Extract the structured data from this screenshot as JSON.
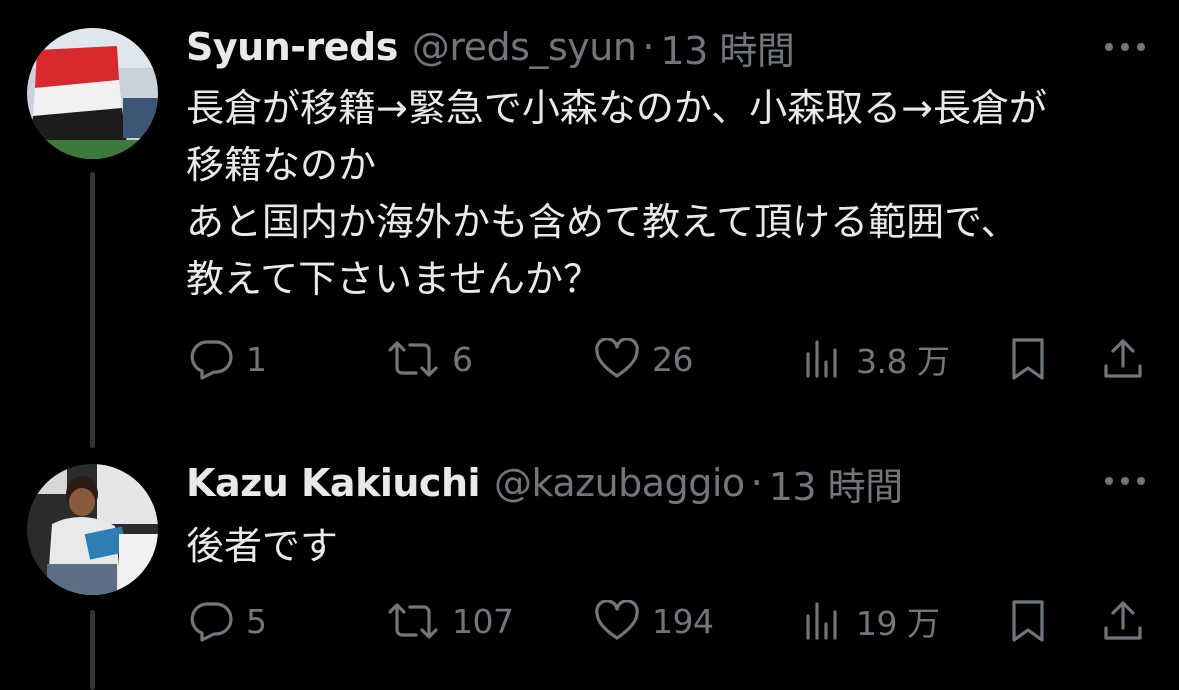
{
  "tweets": [
    {
      "display_name": "Syun-reds",
      "handle": "@reds_syun",
      "separator": "·",
      "time": "13 時間",
      "text_lines": [
        "長倉が移籍→緊急で小森なのか、小森取る→長倉が",
        "移籍なのか",
        "あと国内か海外かも含めて教えて頂ける範囲で、",
        "教えて下さいませんか？"
      ],
      "replies": "1",
      "retweets": "6",
      "likes": "26",
      "views": "3.8 万",
      "icons": {
        "reply": "reply-icon",
        "retweet": "retweet-icon",
        "like": "heart-icon",
        "views": "views-chart-icon",
        "bookmark": "bookmark-icon",
        "share": "share-icon",
        "more": "more-dots-icon"
      }
    },
    {
      "display_name": "Kazu Kakiuchi",
      "handle": "@kazubaggio",
      "separator": "·",
      "time": "13 時間",
      "text_lines": [
        "後者です"
      ],
      "replies": "5",
      "retweets": "107",
      "likes": "194",
      "views": "19 万",
      "icons": {
        "reply": "reply-icon",
        "retweet": "retweet-icon",
        "like": "heart-icon",
        "views": "views-chart-icon",
        "bookmark": "bookmark-icon",
        "share": "share-icon",
        "more": "more-dots-icon"
      }
    }
  ],
  "colors": {
    "background": "#000000",
    "primary_text": "#e7e9ea",
    "secondary_text": "#71767b",
    "thread_line": "#333639"
  }
}
